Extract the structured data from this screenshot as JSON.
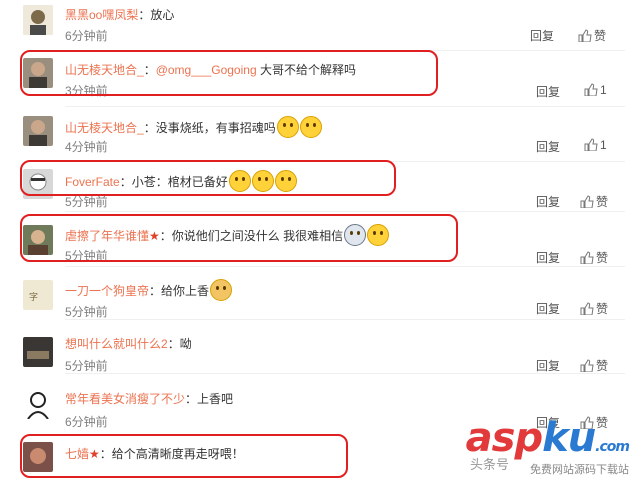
{
  "comments": [
    {
      "user": "黑黑oo嘿凤梨",
      "text": "：放心",
      "time": "6分钟前",
      "reply": "回复",
      "like": "赞"
    },
    {
      "user": "山无棱天地合_",
      "mention": "@omg___Gogoing",
      "text": " 大哥不给个解释吗",
      "time": "3分钟前",
      "reply": "回复",
      "like": "1"
    },
    {
      "user": "山无棱天地合_",
      "text": "：没事烧纸，有事招魂吗",
      "time": "4分钟前",
      "reply": "回复",
      "like": "1"
    },
    {
      "user": "FoverFate",
      "text": "：小苍：棺材已备好",
      "time": "5分钟前",
      "reply": "回复",
      "like": "赞"
    },
    {
      "user": "虐擦了年华谁懂",
      "text": "：你说他们之间没什么   我很难相信",
      "time": "5分钟前",
      "reply": "回复",
      "like": "赞"
    },
    {
      "user": "一刀一个狗皇帝",
      "text": "：给你上香",
      "time": "5分钟前",
      "reply": "回复",
      "like": "赞"
    },
    {
      "user": "想叫什么就叫什么2",
      "text": "：呦",
      "time": "5分钟前",
      "reply": "回复",
      "like": "赞"
    },
    {
      "user": "常年看美女消瘦了不少",
      "text": "：上香吧",
      "time": "6分钟前",
      "reply": "回复",
      "like": "赞"
    },
    {
      "user": "七嫱",
      "text": "：给个高清晰度再走呀喂！",
      "time": "",
      "reply": "",
      "like": ""
    }
  ],
  "mention_sep": "：",
  "watermark": {
    "logo_a": "asp",
    "logo_b": "ku",
    "logo_c": ".com",
    "sub": "免费网站源码下载站",
    "toutiao": "头条号"
  },
  "colors": {
    "username": "#eb7350",
    "highlight": "#e02020"
  }
}
